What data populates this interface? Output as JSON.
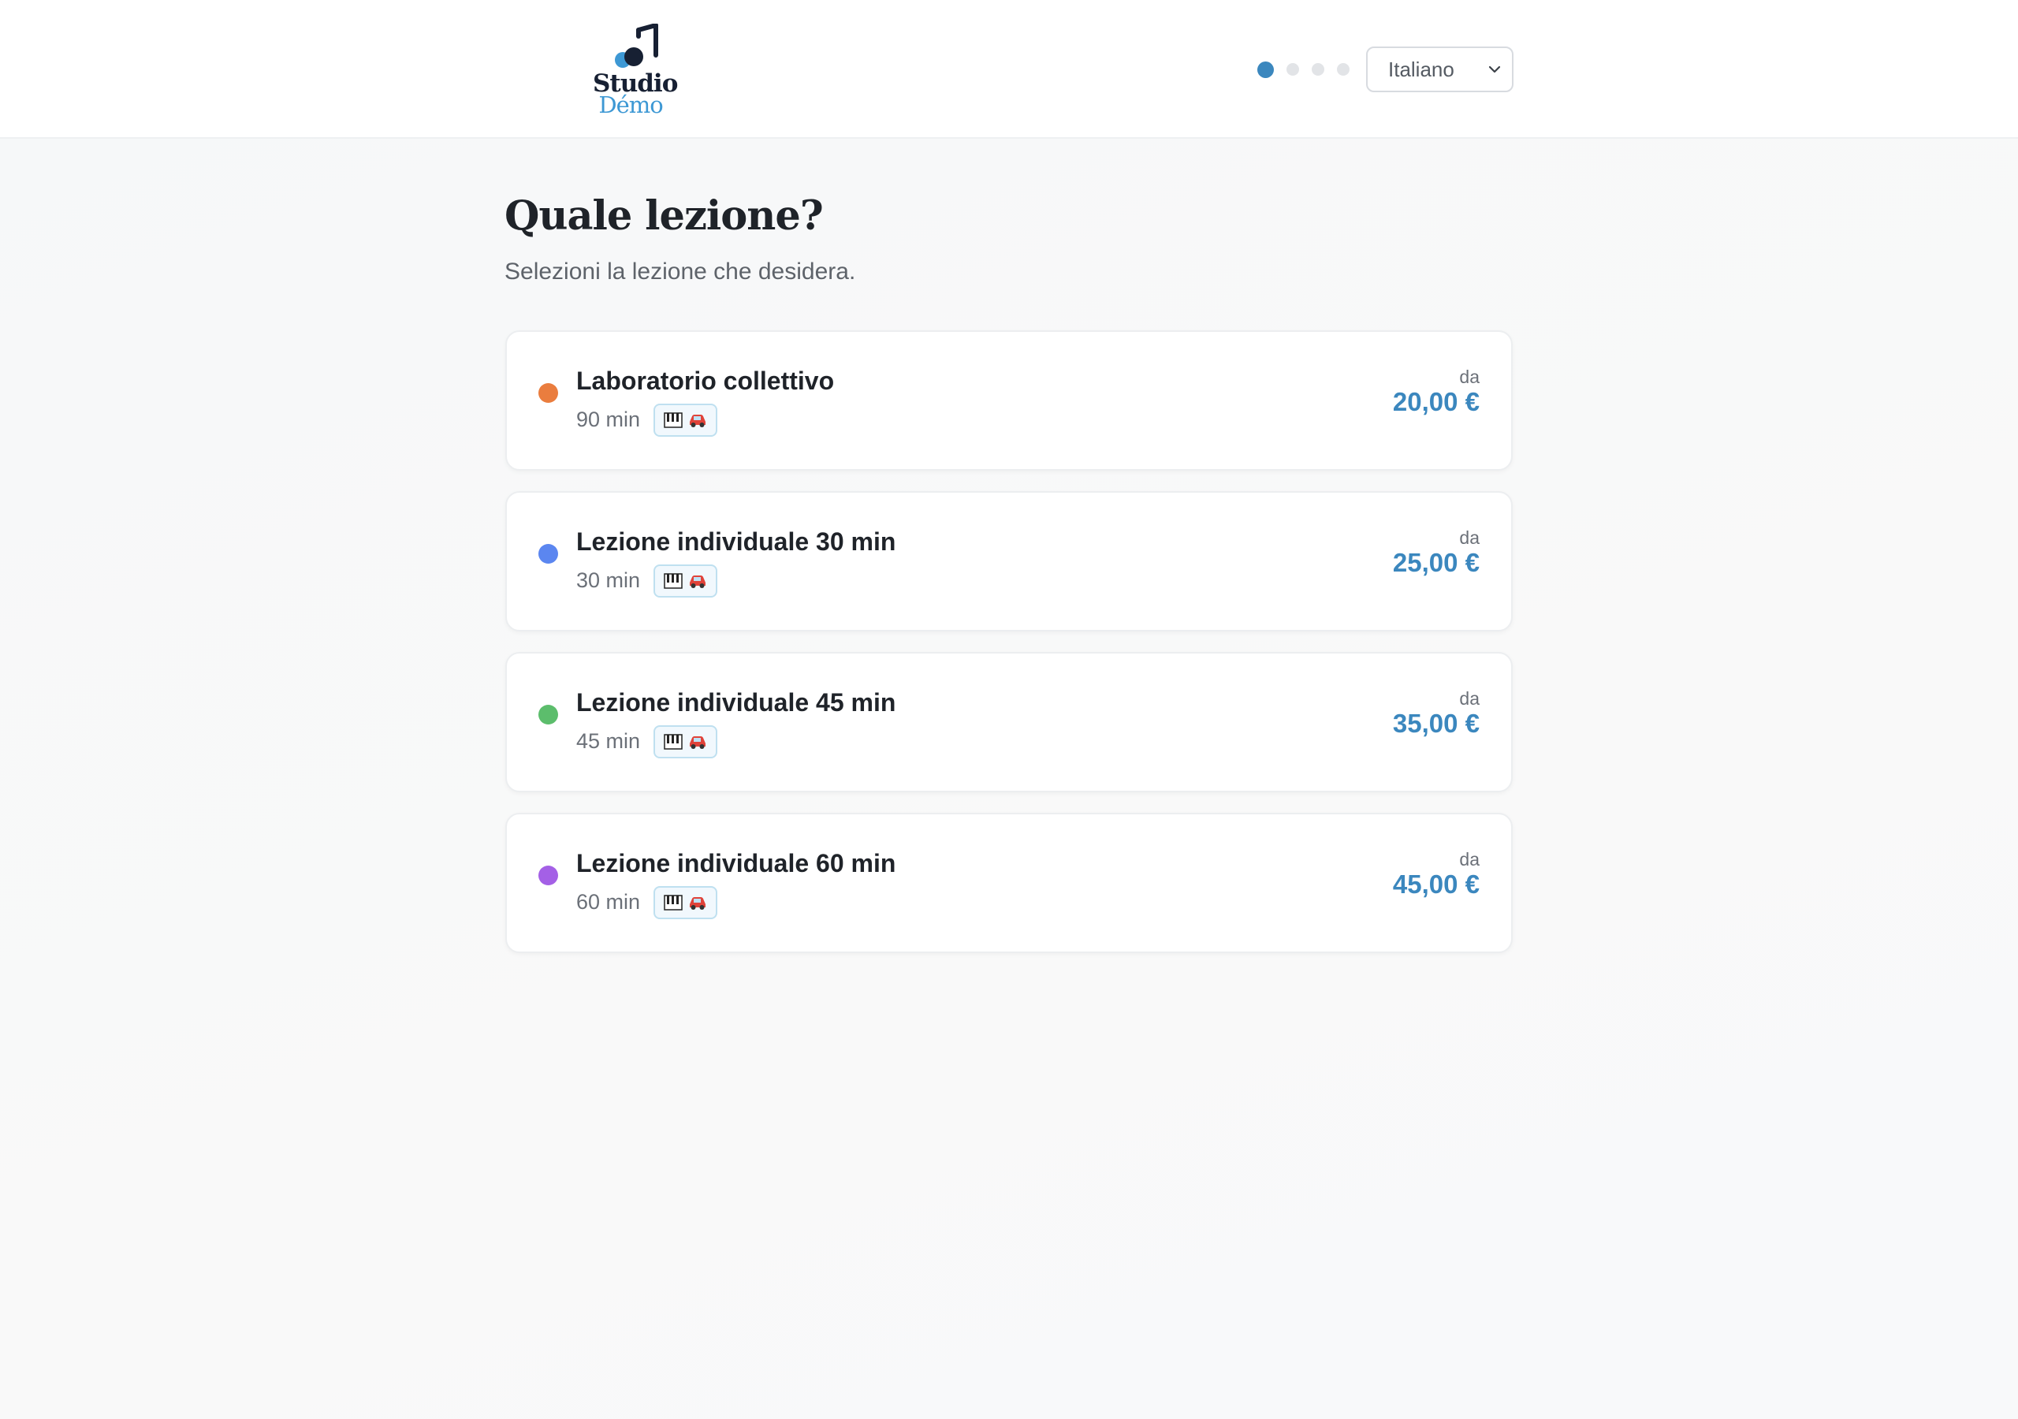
{
  "brand": {
    "line1": "Studio",
    "line2": "Démo",
    "accent": "#3d98d4",
    "dark": "#172033"
  },
  "steps": {
    "total": 4,
    "current": 1
  },
  "language": {
    "selected": "Italiano"
  },
  "page": {
    "title": "Quale lezione?",
    "subtitle": "Selezioni la lezione che desidera."
  },
  "lessons": [
    {
      "name": "Laboratorio collettivo",
      "duration": "90 min",
      "from": "da",
      "price": "20,00 €",
      "color": "#ea7d3e",
      "icons": [
        "piano-icon",
        "car-icon"
      ]
    },
    {
      "name": "Lezione individuale 30 min",
      "duration": "30 min",
      "from": "da",
      "price": "25,00 €",
      "color": "#5b86f0",
      "icons": [
        "piano-icon",
        "car-icon"
      ]
    },
    {
      "name": "Lezione individuale 45 min",
      "duration": "45 min",
      "from": "da",
      "price": "35,00 €",
      "color": "#5cbd6c",
      "icons": [
        "piano-icon",
        "car-icon"
      ]
    },
    {
      "name": "Lezione individuale 60 min",
      "duration": "60 min",
      "from": "da",
      "price": "45,00 €",
      "color": "#a460e6",
      "icons": [
        "piano-icon",
        "car-icon"
      ]
    }
  ],
  "colors": {
    "primary": "#3b87be"
  }
}
